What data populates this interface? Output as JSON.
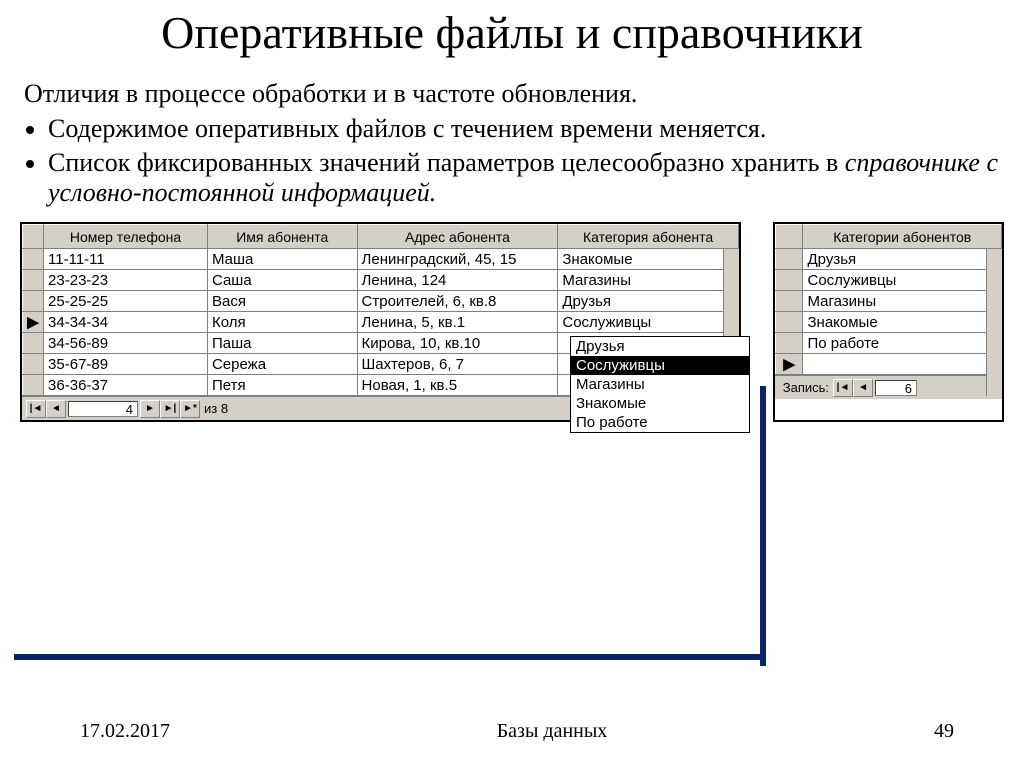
{
  "title": "Оперативные файлы и справочники",
  "lead": "Отличия в процессе обработки и в частоте обновления.",
  "bullets": [
    "Содержимое оперативных файлов с течением времени меняется.",
    "Список фиксированных значений параметров целесообразно хранить в "
  ],
  "bullet2_italic": "справочнике с условно-постоянной информацией.",
  "left_grid": {
    "headers": [
      "Номер телефона",
      "Имя абонента",
      "Адрес абонента",
      "Категория абонента"
    ],
    "rows": [
      [
        "11-11-11",
        "Маша",
        "Ленинградский, 45, 15",
        "Знакомые"
      ],
      [
        "23-23-23",
        "Саша",
        "Ленина, 124",
        "Магазины"
      ],
      [
        "25-25-25",
        "Вася",
        "Строителей, 6, кв.8",
        "Друзья"
      ],
      [
        "34-34-34",
        "Коля",
        "Ленина, 5, кв.1",
        "Сослуживцы"
      ],
      [
        "34-56-89",
        "Паша",
        "Кирова, 10, кв.10",
        ""
      ],
      [
        "35-67-89",
        "Сережа",
        "Шахтеров, 6, 7",
        ""
      ],
      [
        "36-36-37",
        "Петя",
        "Новая, 1, кв.5",
        ""
      ]
    ],
    "active_row": 3,
    "dropdown": {
      "options": [
        "Друзья",
        "Сослуживцы",
        "Магазины",
        "Знакомые",
        "По работе"
      ],
      "selected": "Сослуживцы"
    },
    "nav": {
      "current": "4",
      "total": "из 8"
    }
  },
  "right_grid": {
    "header": "Категории абонентов",
    "rows": [
      "Друзья",
      "Сослуживцы",
      "Магазины",
      "Знакомые",
      "По работе"
    ],
    "nav_label": "Запись:",
    "nav_current": "6"
  },
  "footer": {
    "date": "17.02.2017",
    "center": "Базы данных",
    "page": "49"
  }
}
